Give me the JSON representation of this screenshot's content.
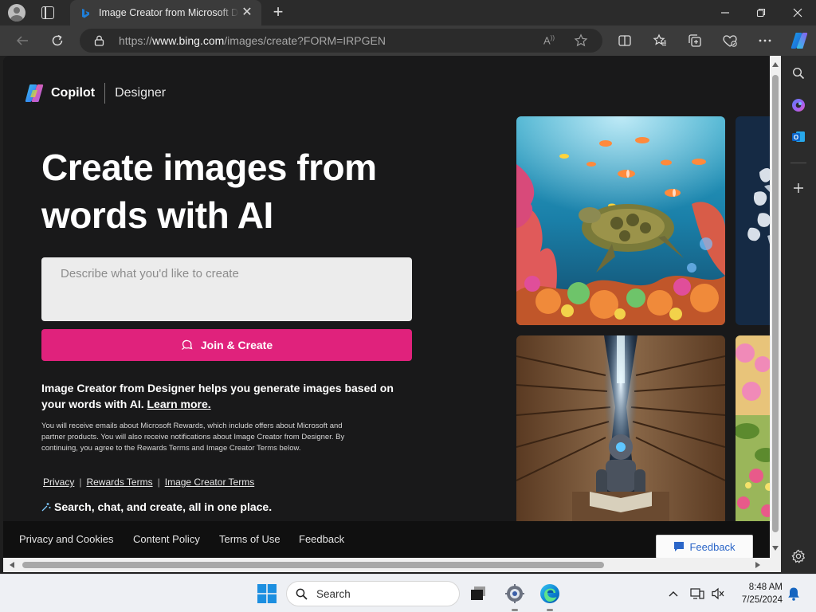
{
  "browser": {
    "tab": {
      "title": "Image Creator from Microsoft Designer"
    },
    "address": {
      "url_prefix": "https://",
      "url_domain": "www.bing.com",
      "url_path": "/images/create?FORM=IRPGEN"
    }
  },
  "page": {
    "brand": {
      "name": "Copilot",
      "product": "Designer"
    },
    "hero_title": "Create images from words with AI",
    "prompt": {
      "placeholder": "Describe what you'd like to create",
      "value": ""
    },
    "join_button": "Join & Create",
    "description": "Image Creator from Designer helps you generate images based on your words with AI.",
    "learn_more": "Learn more.",
    "legal": "You will receive emails about Microsoft Rewards, which include offers about Microsoft and partner products. You will also receive notifications about Image Creator from Designer. By continuing, you agree to the Rewards Terms and Image Creator Terms below.",
    "links": [
      "Privacy",
      "Rewards Terms",
      "Image Creator Terms"
    ],
    "promo": "Search, chat, and create, all in one place.",
    "footer": [
      "Privacy and Cookies",
      "Content Policy",
      "Terms of Use",
      "Feedback"
    ],
    "feedback_button": "Feedback"
  },
  "taskbar": {
    "search_label": "Search",
    "time": "8:48 AM",
    "date": "7/25/2024"
  },
  "colors": {
    "accent_pink": "#e0227c",
    "page_bg": "#19191a",
    "footer_bg": "#101010",
    "edge_blue": "#0c7fd1"
  },
  "icons": [
    "profile-icon",
    "tab-actions-icon",
    "bing-favicon",
    "close-icon",
    "plus-icon",
    "minimize-icon",
    "restore-icon",
    "back-icon",
    "refresh-icon",
    "lock-icon",
    "read-aloud-icon",
    "favorite-star-icon",
    "split-screen-icon",
    "favorites-icon",
    "collections-icon",
    "browser-essentials-icon",
    "more-icon",
    "copilot-icon",
    "search-icon",
    "outlook-icon",
    "settings-icon",
    "windows-start-icon",
    "task-view-icon",
    "edge-icon",
    "notification-bell-icon"
  ]
}
